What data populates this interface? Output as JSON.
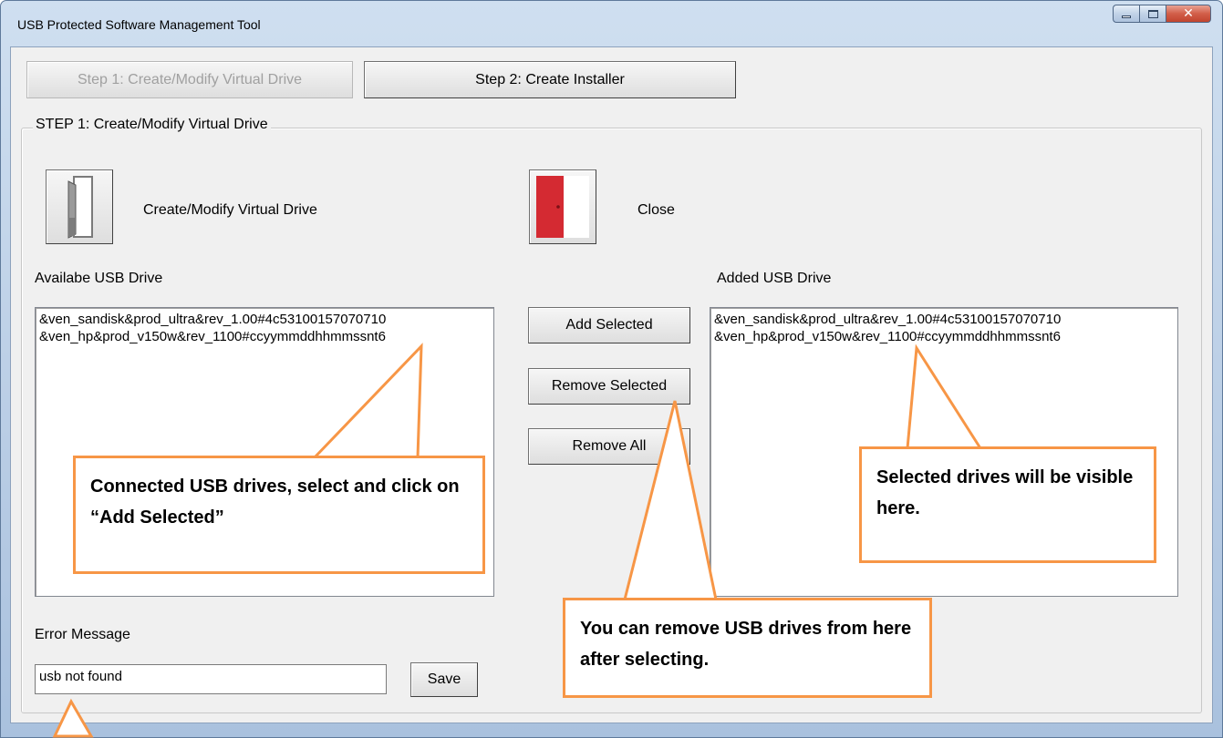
{
  "window": {
    "title": "USB Protected Software Management Tool"
  },
  "steps": {
    "step1_label": "Step 1: Create/Modify Virtual Drive",
    "step2_label": "Step 2: Create Installer"
  },
  "group": {
    "title": "STEP 1: Create/Modify Virtual Drive",
    "create_label": "Create/Modify Virtual Drive",
    "close_label": "Close"
  },
  "available": {
    "label": "Availabe USB Drive",
    "items": [
      "&ven_sandisk&prod_ultra&rev_1.00#4c53100157070710",
      "&ven_hp&prod_v150w&rev_1100#ccyymmddhhmmssnt6"
    ]
  },
  "added": {
    "label": "Added USB Drive",
    "items": [
      "&ven_sandisk&prod_ultra&rev_1.00#4c53100157070710",
      "&ven_hp&prod_v150w&rev_1100#ccyymmddhhmmssnt6"
    ]
  },
  "buttons": {
    "add_selected": "Add Selected",
    "remove_selected": "Remove Selected",
    "remove_all": "Remove All",
    "save": "Save"
  },
  "error": {
    "label": "Error Message",
    "value": "usb not found"
  },
  "callouts": {
    "connected": "Connected USB drives, select and click on “Add Selected”",
    "selected": "Selected drives will be visible here.",
    "remove": "You can remove USB drives from here after selecting."
  },
  "colors": {
    "callout_border": "#f79646",
    "close_door": "#d42a32"
  }
}
